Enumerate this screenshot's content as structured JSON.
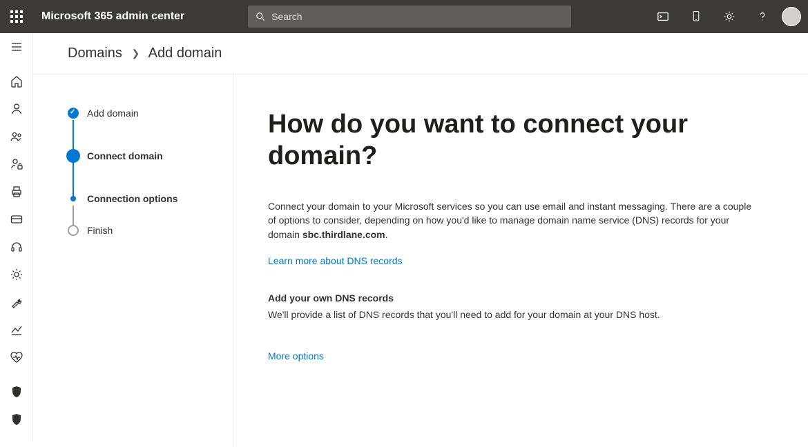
{
  "header": {
    "app_title": "Microsoft 365 admin center",
    "search_placeholder": "Search"
  },
  "breadcrumb": {
    "root": "Domains",
    "current": "Add domain"
  },
  "stepper": {
    "add_domain": "Add domain",
    "connect_domain": "Connect domain",
    "connection_options": "Connection options",
    "finish": "Finish"
  },
  "main": {
    "title": "How do you want to connect your domain?",
    "intro_pre": "Connect your domain to your Microsoft services so you can use email and instant messaging. There are a couple of options to consider, depending on how you'd like to manage domain name service (DNS) records for your domain ",
    "domain_name": "sbc.thirdlane.com",
    "intro_post": ".",
    "learn_link": "Learn more about DNS records",
    "own_dns_heading": "Add your own DNS records",
    "own_dns_body": "We'll provide a list of DNS records that you'll need to add for your domain at your DNS host.",
    "more_options": "More options"
  }
}
